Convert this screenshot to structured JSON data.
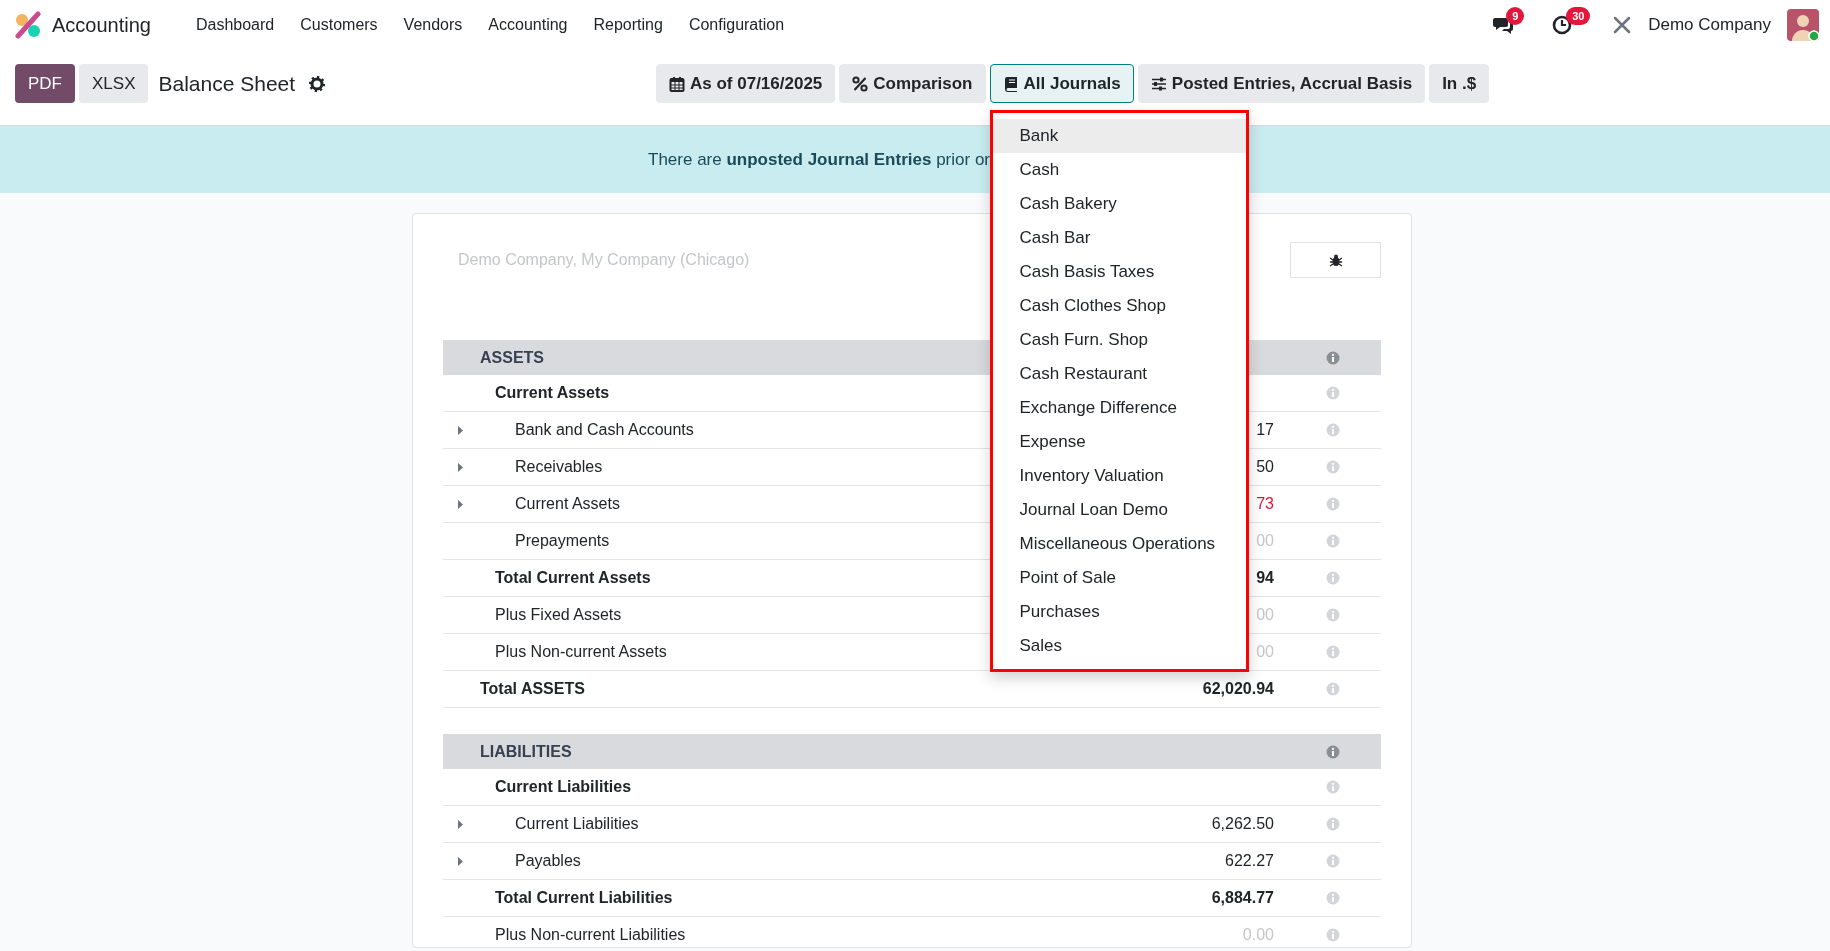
{
  "app": {
    "name": "Accounting"
  },
  "menu": [
    {
      "label": "Dashboard"
    },
    {
      "label": "Customers"
    },
    {
      "label": "Vendors"
    },
    {
      "label": "Accounting"
    },
    {
      "label": "Reporting"
    },
    {
      "label": "Configuration"
    }
  ],
  "systray": {
    "messages_badge": "9",
    "activities_badge": "30",
    "company": "Demo Company"
  },
  "toolbar": {
    "buttons": [
      {
        "label": "PDF",
        "kind": "primary"
      },
      {
        "label": "XLSX",
        "kind": "secondary"
      }
    ],
    "title": "Balance Sheet"
  },
  "filters": [
    {
      "kind": "date",
      "label": "As of 07/16/2025",
      "selected": false
    },
    {
      "kind": "comparison",
      "label": "Comparison",
      "selected": false
    },
    {
      "kind": "journals",
      "label": "All Journals",
      "selected": true
    },
    {
      "kind": "options",
      "label": "Posted Entries, Accrual Basis",
      "selected": false
    },
    {
      "kind": "currency",
      "label": "In .$",
      "selected": false
    }
  ],
  "journals_menu": [
    {
      "label": "Bank",
      "selected": true
    },
    {
      "label": "Cash",
      "selected": false
    },
    {
      "label": "Cash Bakery",
      "selected": false
    },
    {
      "label": "Cash Bar",
      "selected": false
    },
    {
      "label": "Cash Basis Taxes",
      "selected": false
    },
    {
      "label": "Cash Clothes Shop",
      "selected": false
    },
    {
      "label": "Cash Furn. Shop",
      "selected": false
    },
    {
      "label": "Cash Restaurant",
      "selected": false
    },
    {
      "label": "Exchange Difference",
      "selected": false
    },
    {
      "label": "Expense",
      "selected": false
    },
    {
      "label": "Inventory Valuation",
      "selected": false
    },
    {
      "label": "Journal Loan Demo",
      "selected": false
    },
    {
      "label": "Miscellaneous Operations",
      "selected": false
    },
    {
      "label": "Point of Sale",
      "selected": false
    },
    {
      "label": "Purchases",
      "selected": false
    },
    {
      "label": "Sales",
      "selected": false
    }
  ],
  "banner": {
    "text": "There are **unposted Journal Entries** prior or"
  },
  "report": {
    "companies": "Demo Company, My Company (Chicago)",
    "rows": [
      {
        "kind": "section",
        "label": "ASSETS"
      },
      {
        "kind": "group",
        "label": "Current Assets"
      },
      {
        "kind": "line",
        "label": "Bank and Cash Accounts",
        "amount": "17",
        "negative": false,
        "muted": false,
        "expanded": false
      },
      {
        "kind": "line",
        "label": "Receivables",
        "amount": "50",
        "negative": false,
        "muted": false,
        "expanded": false
      },
      {
        "kind": "line",
        "label": "Current Assets",
        "amount": "73",
        "negative": true,
        "muted": false,
        "expanded": false
      },
      {
        "kind": "plain",
        "label": "Prepayments",
        "amount": "00",
        "negative": false,
        "muted": true
      },
      {
        "kind": "total",
        "label": "Total Current Assets",
        "amount": "94",
        "negative": false,
        "muted": false
      },
      {
        "kind": "plus",
        "label": "Plus Fixed Assets",
        "amount": "00",
        "negative": false,
        "muted": true
      },
      {
        "kind": "plus",
        "label": "Plus Non-current Assets",
        "amount": "00",
        "negative": false,
        "muted": true
      },
      {
        "kind": "grand",
        "label": "Total ASSETS",
        "amount": "62,020.94",
        "negative": false,
        "muted": false
      },
      {
        "kind": "section",
        "label": "LIABILITIES"
      },
      {
        "kind": "group",
        "label": "Current Liabilities"
      },
      {
        "kind": "line",
        "label": "Current Liabilities",
        "amount": "6,262.50",
        "negative": false,
        "muted": false,
        "expanded": false
      },
      {
        "kind": "line",
        "label": "Payables",
        "amount": "622.27",
        "negative": false,
        "muted": false,
        "expanded": false
      },
      {
        "kind": "total",
        "label": "Total Current Liabilities",
        "amount": "6,884.77",
        "negative": false,
        "muted": false
      },
      {
        "kind": "plus",
        "label": "Plus Non-current Liabilities",
        "amount": "0.00",
        "negative": false,
        "muted": true
      }
    ]
  }
}
